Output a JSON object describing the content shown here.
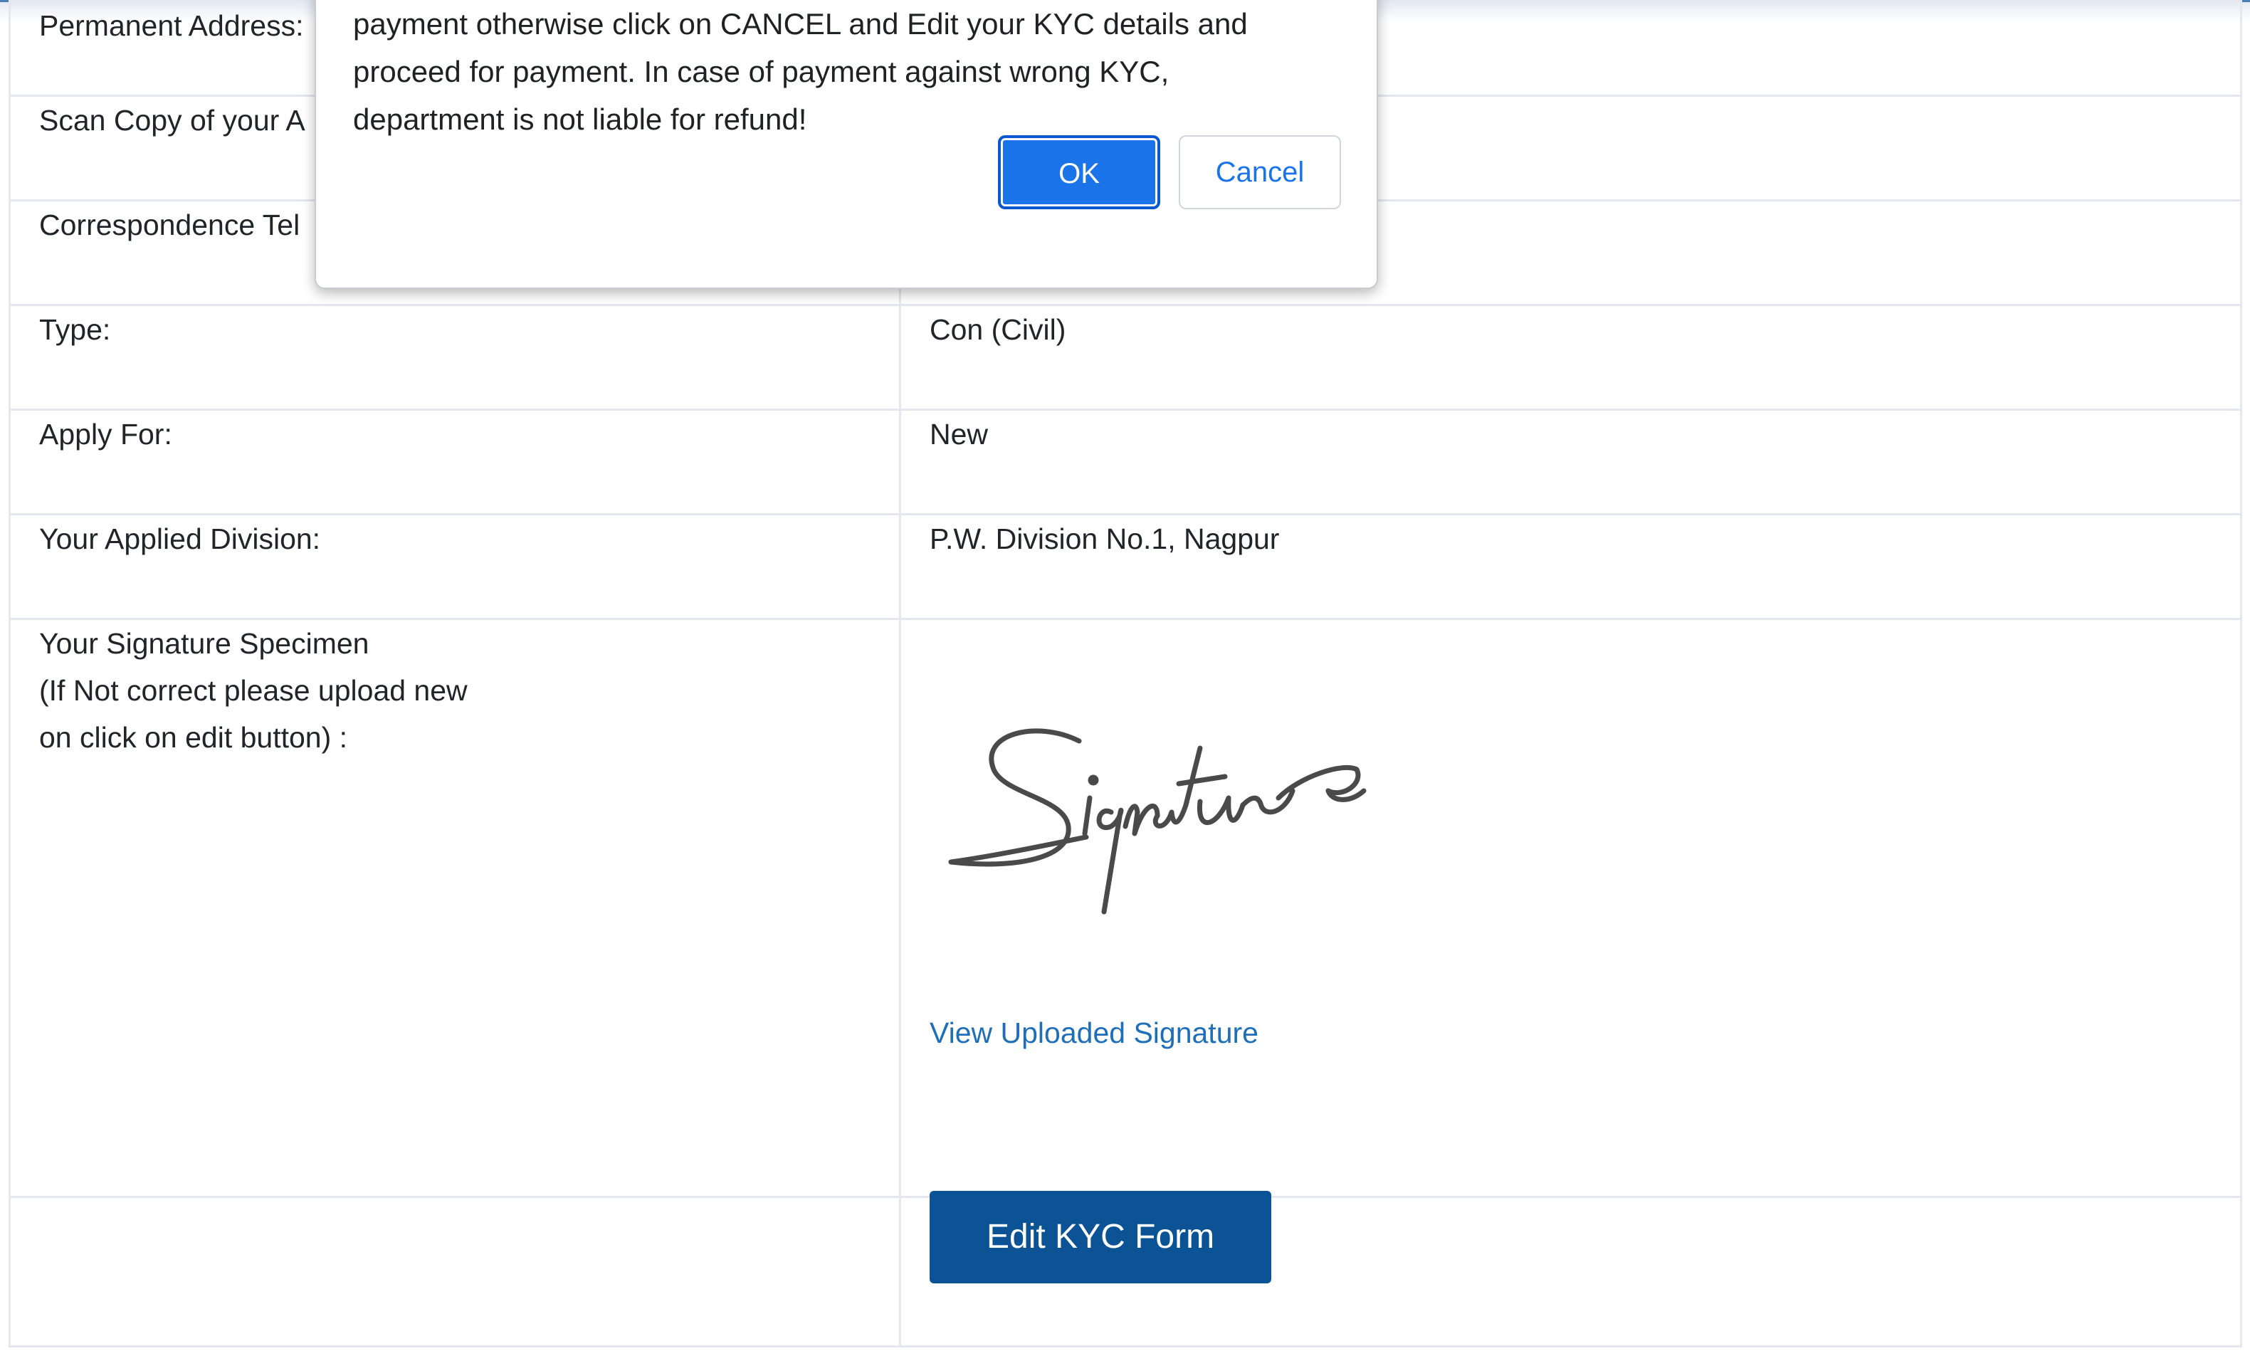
{
  "table": {
    "rows": [
      {
        "label": "Permanent Address:",
        "value": ""
      },
      {
        "label": "Scan Copy of your A",
        "value": ""
      },
      {
        "label": "Correspondence Tel",
        "value": ""
      },
      {
        "label": "Type:",
        "value": "Con (Civil)"
      },
      {
        "label": "Apply For:",
        "value": "New"
      },
      {
        "label": "Your Applied Division:",
        "value": "P.W. Division No.1, Nagpur"
      }
    ],
    "signature": {
      "label_line1": "Your Signature Specimen",
      "label_line2": "(If Not correct please upload new",
      "label_line3": "on click on edit button) :",
      "image_text": "Signature",
      "view_link": "View Uploaded Signature"
    },
    "edit_button": "Edit KYC Form"
  },
  "dialog": {
    "line1": "payment otherwise click on CANCEL and Edit your KYC details and",
    "line2": "proceed for payment. In case of payment against wrong KYC,",
    "line3": "department is not liable for refund!",
    "ok_label": "OK",
    "cancel_label": "Cancel"
  },
  "colors": {
    "link": "#1f6fb8",
    "primary_button": "#0b5394",
    "dialog_ok": "#1a73e8"
  }
}
